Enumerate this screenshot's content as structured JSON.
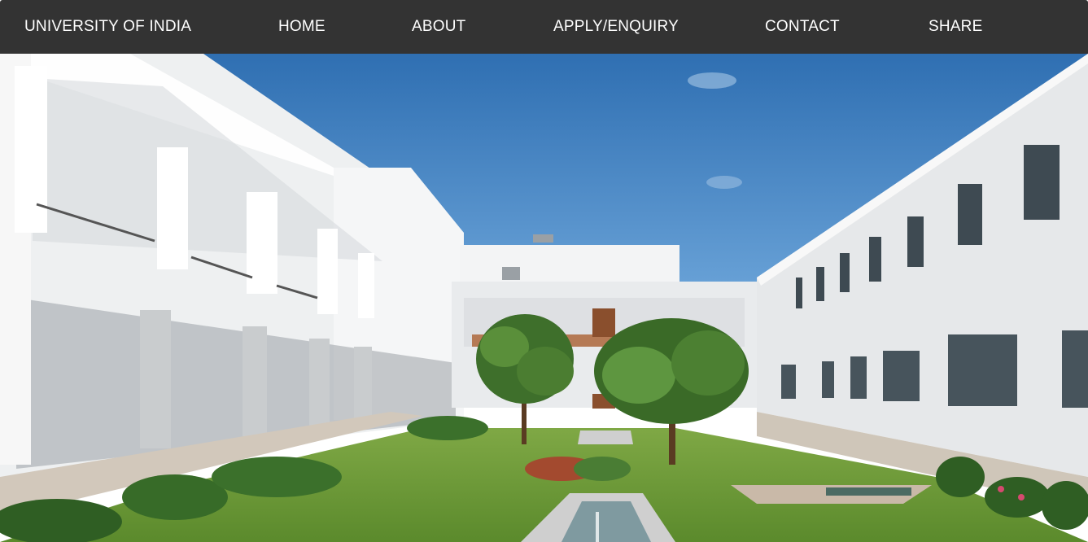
{
  "navbar": {
    "brand": "UNIVERSITY OF INDIA",
    "links": [
      "HOME",
      "ABOUT",
      "APPLY/ENQUIRY",
      "CONTACT",
      "SHARE"
    ]
  },
  "colors": {
    "navbar_bg": "#333333",
    "nav_text": "#ffffff",
    "sky": "#3f7fbf",
    "building": "#eef0f1",
    "lawn": "#6f9a3a"
  },
  "hero": {
    "description_icon": "campus-courtyard-photo"
  }
}
